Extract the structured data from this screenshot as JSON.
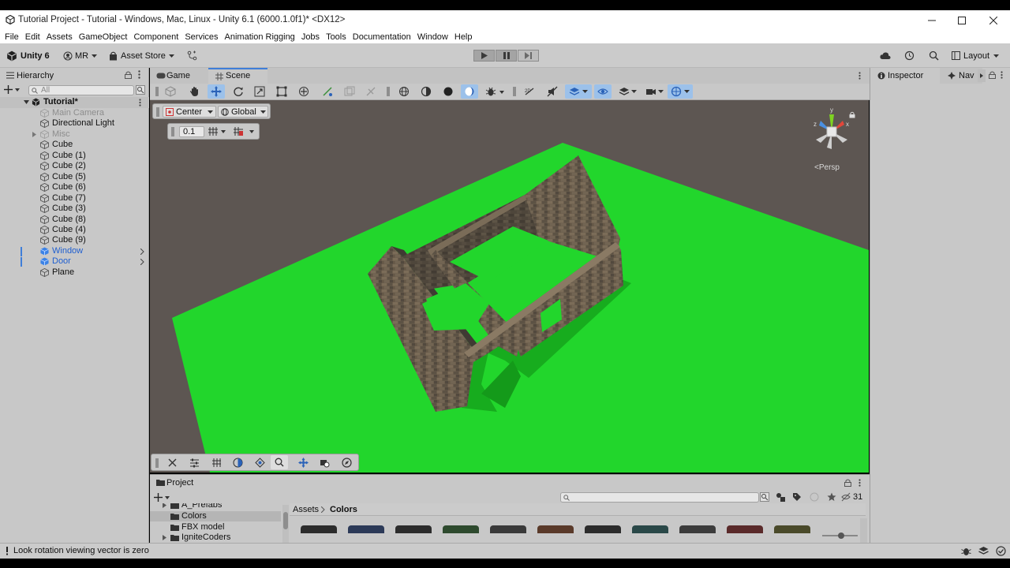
{
  "window": {
    "title": "Tutorial Project - Tutorial - Windows, Mac, Linux - Unity 6.1 (6000.1.0f1)* <DX12>"
  },
  "menu": [
    "File",
    "Edit",
    "Assets",
    "GameObject",
    "Component",
    "Services",
    "Animation Rigging",
    "Jobs",
    "Tools",
    "Documentation",
    "Window",
    "Help"
  ],
  "toolbar": {
    "unity_label": "Unity 6",
    "account_label": "MR",
    "asset_store_label": "Asset Store",
    "layout_label": "Layout"
  },
  "hierarchy": {
    "tab_label": "Hierarchy",
    "search_placeholder": "All",
    "scene_name": "Tutorial*",
    "items": [
      {
        "label": "Main Camera",
        "state": "disabled"
      },
      {
        "label": "Directional Light",
        "state": "normal"
      },
      {
        "label": "Misc",
        "state": "disabled",
        "expandable": true
      },
      {
        "label": "Cube",
        "state": "normal"
      },
      {
        "label": "Cube (1)",
        "state": "normal"
      },
      {
        "label": "Cube (2)",
        "state": "normal"
      },
      {
        "label": "Cube (5)",
        "state": "normal"
      },
      {
        "label": "Cube (6)",
        "state": "normal"
      },
      {
        "label": "Cube (7)",
        "state": "normal"
      },
      {
        "label": "Cube (3)",
        "state": "normal"
      },
      {
        "label": "Cube (8)",
        "state": "normal"
      },
      {
        "label": "Cube (4)",
        "state": "normal"
      },
      {
        "label": "Cube (9)",
        "state": "normal"
      },
      {
        "label": "Window",
        "state": "prefab"
      },
      {
        "label": "Door",
        "state": "prefab"
      },
      {
        "label": "Plane",
        "state": "normal"
      }
    ]
  },
  "scene_view": {
    "tabs": [
      "Game",
      "Scene"
    ],
    "active_tab": "Scene",
    "pivot_label": "Center",
    "space_label": "Global",
    "snap_value": "0.1",
    "gizmo_label": "Persp",
    "gizmo_axes": [
      "y",
      "z",
      "x"
    ]
  },
  "inspector": {
    "tab_label": "Inspector",
    "nav_tab_label": "Nav"
  },
  "project": {
    "tab_label": "Project",
    "folders": [
      "A_Prefabs",
      "Colors",
      "FBX model",
      "IgniteCoders"
    ],
    "selected_folder": "Colors",
    "breadcrumb_root": "Assets",
    "breadcrumb_current": "Colors",
    "asset_count": "31"
  },
  "status": {
    "message": "Look rotation viewing vector is zero"
  },
  "colors": {
    "accent": "#3f7ed8",
    "ground": "#22d62c",
    "prefab_text": "#1f5fd0"
  }
}
